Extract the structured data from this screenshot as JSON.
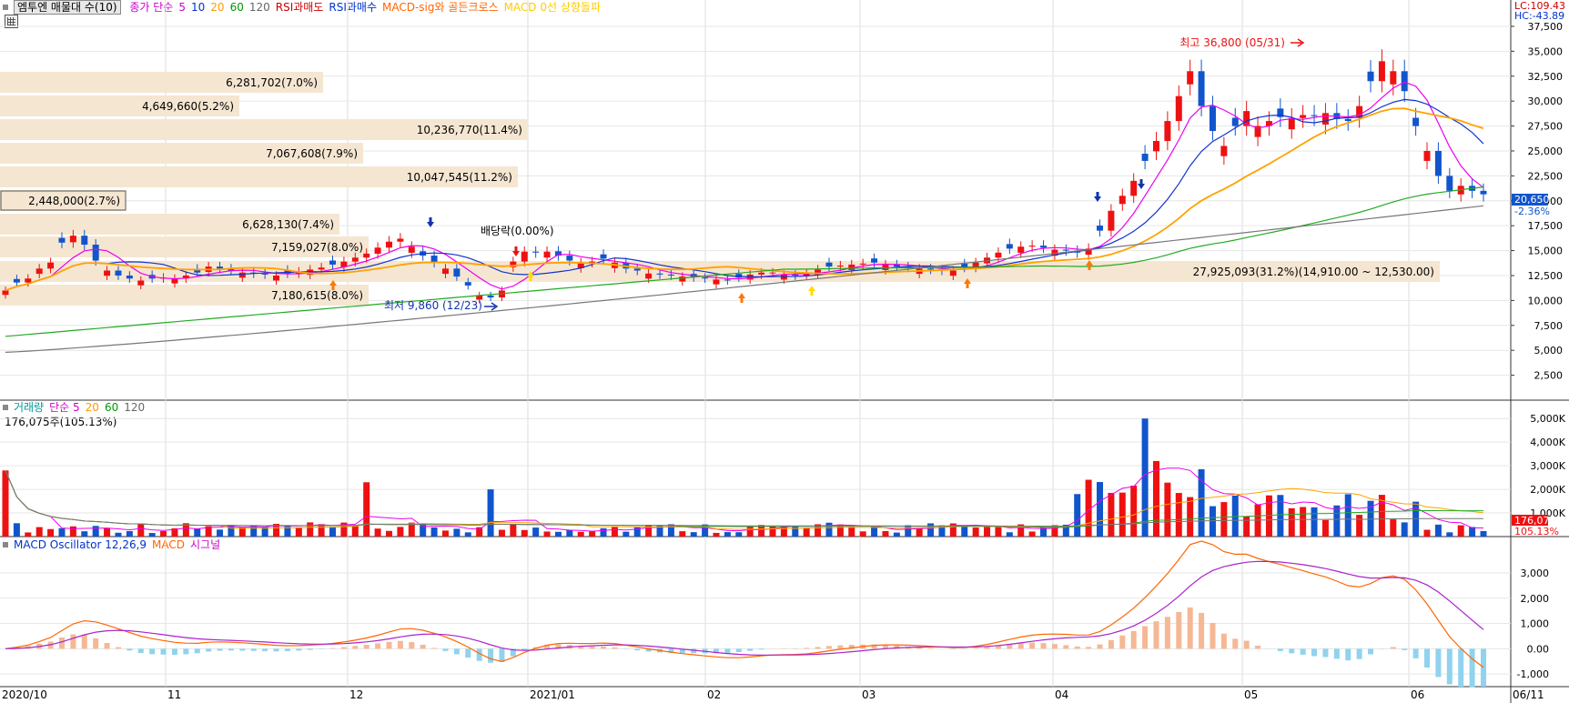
{
  "legend_top": {
    "stock_name": "엠투엔 매물대 수(10)",
    "items": [
      {
        "label": "종가 단순",
        "color": "#cc00cc"
      },
      {
        "label": "5",
        "color": "#cc00cc"
      },
      {
        "label": "10",
        "color": "#0033cc"
      },
      {
        "label": "20",
        "color": "#ff9900"
      },
      {
        "label": "60",
        "color": "#009900"
      },
      {
        "label": "120",
        "color": "#666666"
      },
      {
        "label": "RSI과매도",
        "color": "#cc0000"
      },
      {
        "label": "RSI과매수",
        "color": "#0033cc"
      },
      {
        "label": "MACD-sig와 골든크로스",
        "color": "#ff6600"
      },
      {
        "label": "MACD 0선 상향돌파",
        "color": "#ffcc00"
      }
    ]
  },
  "price_axis_top": {
    "lc": "LC:109.43",
    "hc": "HC:-43.89"
  },
  "current_price": {
    "value": "20,650",
    "change": "-2.36%"
  },
  "price_ticks": [
    "37,500",
    "35,000",
    "32,500",
    "30,000",
    "27,500",
    "25,000",
    "22,500",
    "20,000",
    "17,500",
    "15,000",
    "12,500",
    "10,000",
    "7,500",
    "5,000",
    "2,500"
  ],
  "volume_profile": [
    "6,281,702(7.0%)",
    "4,649,660(5.2%)",
    "10,236,770(11.4%)",
    "7,067,608(7.9%)",
    "10,047,545(11.2%)",
    "2,448,000(2.7%)",
    "6,628,130(7.4%)",
    "7,159,027(8.0%)",
    "27,925,093(31.2%)(14,910.00 ~ 12,530.00)",
    "7,180,615(8.0%)"
  ],
  "annotations": {
    "high": "최고 36,800 (05/31)",
    "low": "최저 9,860 (12/23)",
    "dividend": "배당락(0.00%)"
  },
  "volume_legend": {
    "items": [
      {
        "label": "거래량",
        "color": "#009999"
      },
      {
        "label": "단순 5",
        "color": "#cc00cc"
      },
      {
        "label": "20",
        "color": "#ff9900"
      },
      {
        "label": "60",
        "color": "#009900"
      },
      {
        "label": "120",
        "color": "#666666"
      }
    ],
    "value": "176,075주(105.13%)"
  },
  "volume_ticks": [
    "5,000K",
    "4,000K",
    "3,000K",
    "2,000K",
    "1,000K"
  ],
  "volume_current": {
    "value": "176,075",
    "pct": "105.13%"
  },
  "macd_legend": {
    "items": [
      {
        "label": "MACD Oscillator 12,26,9",
        "color": "#0033cc"
      },
      {
        "label": "MACD",
        "color": "#ff6600"
      },
      {
        "label": "시그널",
        "color": "#cc00cc"
      }
    ]
  },
  "macd_ticks": [
    "3,000",
    "2,000",
    "1,000",
    "0.00",
    "-1,000"
  ],
  "x_labels": [
    "2020/10",
    "11",
    "12",
    "2021/01",
    "02",
    "03",
    "04",
    "05",
    "06",
    "06/11"
  ],
  "colors": {
    "up": "#ee1111",
    "down": "#1155cc",
    "profile": "#f5e6d2",
    "ma5": "#ee00ee",
    "ma10": "#1133cc",
    "ma20": "#ffa200",
    "ma60": "#22aa22",
    "ma120": "#777777"
  },
  "chart_data": [
    {
      "type": "candlestick",
      "title": "엠투엔",
      "y_range": [
        0,
        38500
      ],
      "close_series_approx": [
        11000,
        11800,
        12200,
        13200,
        13800,
        15800,
        16500,
        15600,
        14000,
        13000,
        12500,
        12200,
        12000,
        12200,
        12300,
        12200,
        12500,
        12800,
        13400,
        13200,
        13000,
        12800,
        12700,
        12600,
        12500,
        12700,
        12900,
        13100,
        13300,
        13600,
        13900,
        14300,
        14700,
        15300,
        15900,
        16200,
        15400,
        14500,
        13800,
        13200,
        12400,
        11500,
        10500,
        10300,
        11000,
        13900,
        14900,
        14800,
        14900,
        14500,
        14000,
        13800,
        13900,
        14200,
        13800,
        13200,
        13000,
        12700,
        12600,
        12500,
        12400,
        12300,
        12200,
        12100,
        12000,
        12300,
        12600,
        12800,
        12800,
        12600,
        12500,
        12700,
        13100,
        13400,
        13500,
        13600,
        13700,
        13800,
        13600,
        13400,
        13300,
        13200,
        13100,
        13000,
        13000,
        13300,
        13800,
        14300,
        14800,
        15200,
        15400,
        15500,
        15300,
        15100,
        15000,
        14800,
        15200,
        17000,
        19000,
        20500,
        22000,
        24000,
        26000,
        28000,
        30500,
        33000,
        29500,
        27000,
        25500,
        27500,
        29000,
        27500,
        28000,
        28400,
        28300,
        28600,
        28500,
        28800,
        28200,
        28000,
        29500,
        32000,
        34000,
        33000,
        31000,
        27500,
        25000,
        22500,
        21000,
        21500,
        21000,
        20650
      ],
      "moving_averages": [
        "5",
        "10",
        "20",
        "60",
        "120"
      ],
      "high": {
        "value": 36800,
        "date": "05/31"
      },
      "low": {
        "value": 9860,
        "date": "12/23"
      },
      "last_close": 20650
    },
    {
      "type": "bar",
      "title": "거래량",
      "y_unit": "K",
      "y_range": [
        0,
        5200
      ],
      "last_value": 176.075
    },
    {
      "type": "line",
      "title": "MACD Oscillator 12,26,9",
      "series": [
        {
          "name": "MACD"
        },
        {
          "name": "시그널"
        }
      ],
      "y_range": [
        -1500,
        3900
      ]
    }
  ]
}
